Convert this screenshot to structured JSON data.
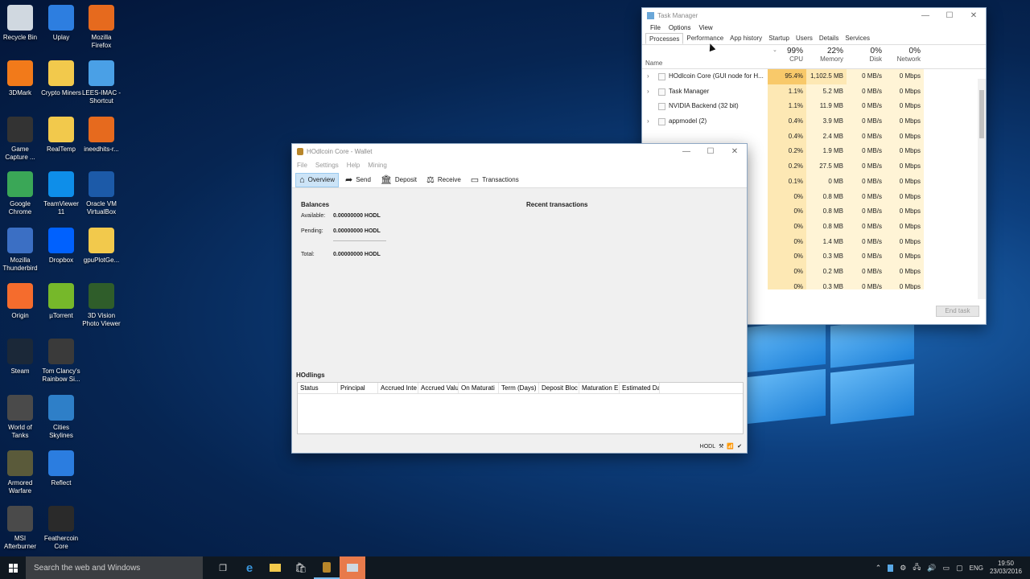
{
  "desktop": {
    "icons": [
      {
        "label": "Recycle Bin",
        "icon": "recycle-bin-icon",
        "color": "#d0d8e0"
      },
      {
        "label": "Uplay",
        "icon": "uplay-icon",
        "color": "#2d7ee0"
      },
      {
        "label": "Mozilla Firefox",
        "icon": "firefox-icon",
        "color": "#e66a1e"
      },
      {
        "label": "3DMark",
        "icon": "3dmark-icon",
        "color": "#f27a1a"
      },
      {
        "label": "Crypto Miners",
        "icon": "folder-icon",
        "color": "#f2c94c"
      },
      {
        "label": "LEES-IMAC - Shortcut",
        "icon": "computer-icon",
        "color": "#4aa0e6"
      },
      {
        "label": "Game Capture ...",
        "icon": "game-capture-icon",
        "color": "#333333"
      },
      {
        "label": "RealTemp",
        "icon": "folder-icon",
        "color": "#f2c94c"
      },
      {
        "label": "ineedhits-r...",
        "icon": "firefox-doc-icon",
        "color": "#e66a1e"
      },
      {
        "label": "Google Chrome",
        "icon": "chrome-icon",
        "color": "#3aa757"
      },
      {
        "label": "TeamViewer 11",
        "icon": "teamviewer-icon",
        "color": "#0e8ee9"
      },
      {
        "label": "Oracle VM VirtualBox",
        "icon": "virtualbox-icon",
        "color": "#1c5aa8"
      },
      {
        "label": "Mozilla Thunderbird",
        "icon": "thunderbird-icon",
        "color": "#3b6fc4"
      },
      {
        "label": "Dropbox",
        "icon": "dropbox-icon",
        "color": "#0061fe"
      },
      {
        "label": "gpuPlotGe...",
        "icon": "folder-icon",
        "color": "#f2c94c"
      },
      {
        "label": "Origin",
        "icon": "origin-icon",
        "color": "#f56c2d"
      },
      {
        "label": "µTorrent",
        "icon": "utorrent-icon",
        "color": "#76b82a"
      },
      {
        "label": "3D Vision Photo Viewer",
        "icon": "nvidia-icon",
        "color": "#2f5d2a"
      },
      {
        "label": "Steam",
        "icon": "steam-icon",
        "color": "#1b2838"
      },
      {
        "label": "Tom Clancy's Rainbow Si...",
        "icon": "rainbow-six-icon",
        "color": "#3a3a3a"
      },
      {
        "label": "World of Tanks",
        "icon": "tanks-icon",
        "color": "#4a4a4a"
      },
      {
        "label": "Cities Skylines",
        "icon": "cities-icon",
        "color": "#2e7fc8"
      },
      {
        "label": "Armored Warfare",
        "icon": "armored-warfare-icon",
        "color": "#5a5a3a"
      },
      {
        "label": "Reflect",
        "icon": "reflect-icon",
        "color": "#2b7de0"
      },
      {
        "label": "MSI Afterburner",
        "icon": "afterburner-icon",
        "color": "#4a4a4a"
      },
      {
        "label": "Feathercoin Core",
        "icon": "feathercoin-icon",
        "color": "#2a2a2a"
      }
    ]
  },
  "taskmgr": {
    "title": "Task Manager",
    "menu": [
      "File",
      "Options",
      "View"
    ],
    "tabs": [
      "Processes",
      "Performance",
      "App history",
      "Startup",
      "Users",
      "Details",
      "Services"
    ],
    "columns": {
      "name": "Name",
      "cpu_pct": "99%",
      "cpu": "CPU",
      "mem_pct": "22%",
      "mem": "Memory",
      "disk_pct": "0%",
      "disk": "Disk",
      "net_pct": "0%",
      "net": "Network"
    },
    "rows": [
      {
        "name": "HOdlcoin Core (GUI node for H...",
        "cpu": "95.4%",
        "mem": "1,102.5 MB",
        "disk": "0 MB/s",
        "net": "0 Mbps",
        "exp": "›"
      },
      {
        "name": "Task Manager",
        "cpu": "1.1%",
        "mem": "5.2 MB",
        "disk": "0 MB/s",
        "net": "0 Mbps",
        "exp": "›"
      },
      {
        "name": "NVIDIA Backend (32 bit)",
        "cpu": "1.1%",
        "mem": "11.9 MB",
        "disk": "0 MB/s",
        "net": "0 Mbps",
        "exp": ""
      },
      {
        "name": "appmodel (2)",
        "cpu": "0.4%",
        "mem": "3.9 MB",
        "disk": "0 MB/s",
        "net": "0 Mbps",
        "exp": "›"
      },
      {
        "name": "",
        "cpu": "0.4%",
        "mem": "2.4 MB",
        "disk": "0 MB/s",
        "net": "0 Mbps",
        "exp": ""
      },
      {
        "name": "",
        "cpu": "0.2%",
        "mem": "1.9 MB",
        "disk": "0 MB/s",
        "net": "0 Mbps",
        "exp": ""
      },
      {
        "name": "",
        "cpu": "0.2%",
        "mem": "27.5 MB",
        "disk": "0 MB/s",
        "net": "0 Mbps",
        "exp": ""
      },
      {
        "name": "",
        "cpu": "0.1%",
        "mem": "0 MB",
        "disk": "0 MB/s",
        "net": "0 Mbps",
        "exp": ""
      },
      {
        "name": "",
        "cpu": "0%",
        "mem": "0.8 MB",
        "disk": "0 MB/s",
        "net": "0 Mbps",
        "exp": ""
      },
      {
        "name": "",
        "cpu": "0%",
        "mem": "0.8 MB",
        "disk": "0 MB/s",
        "net": "0 Mbps",
        "exp": ""
      },
      {
        "name": "",
        "cpu": "0%",
        "mem": "0.8 MB",
        "disk": "0 MB/s",
        "net": "0 Mbps",
        "exp": ""
      },
      {
        "name": "",
        "cpu": "0%",
        "mem": "1.4 MB",
        "disk": "0 MB/s",
        "net": "0 Mbps",
        "exp": ""
      },
      {
        "name": "",
        "cpu": "0%",
        "mem": "0.3 MB",
        "disk": "0 MB/s",
        "net": "0 Mbps",
        "exp": ""
      },
      {
        "name": "",
        "cpu": "0%",
        "mem": "0.2 MB",
        "disk": "0 MB/s",
        "net": "0 Mbps",
        "exp": ""
      },
      {
        "name": "",
        "cpu": "0%",
        "mem": "0.3 MB",
        "disk": "0 MB/s",
        "net": "0 Mbps",
        "exp": ""
      }
    ],
    "end_task": "End task",
    "colors": {
      "hot": "#f8c96a",
      "warm": "#fde8b4",
      "light": "#fff4d6"
    }
  },
  "wallet": {
    "title": "HOdlcoin Core - Wallet",
    "menu": [
      "File",
      "Settings",
      "Help",
      "Mining"
    ],
    "toolbar": {
      "overview": "Overview",
      "send": "Send",
      "deposit": "Deposit",
      "receive": "Receive",
      "transactions": "Transactions"
    },
    "balances": {
      "heading": "Balances",
      "available_label": "Available:",
      "available_value": "0.00000000 HODL",
      "pending_label": "Pending:",
      "pending_value": "0.00000000 HODL",
      "total_label": "Total:",
      "total_value": "0.00000000 HODL"
    },
    "recent_heading": "Recent transactions",
    "hodlings": {
      "heading": "HOdlings",
      "columns": [
        "Status",
        "Principal",
        "Accrued Inte",
        "Accrued Valu",
        "On Maturati",
        "Term (Days)",
        "Deposit Bloc",
        "Maturation E",
        "Estimated Da"
      ]
    },
    "status_unit": "HODL"
  },
  "taskbar": {
    "search_placeholder": "Search the web and Windows",
    "lang": "ENG",
    "time": "19:50",
    "date": "23/03/2016"
  }
}
